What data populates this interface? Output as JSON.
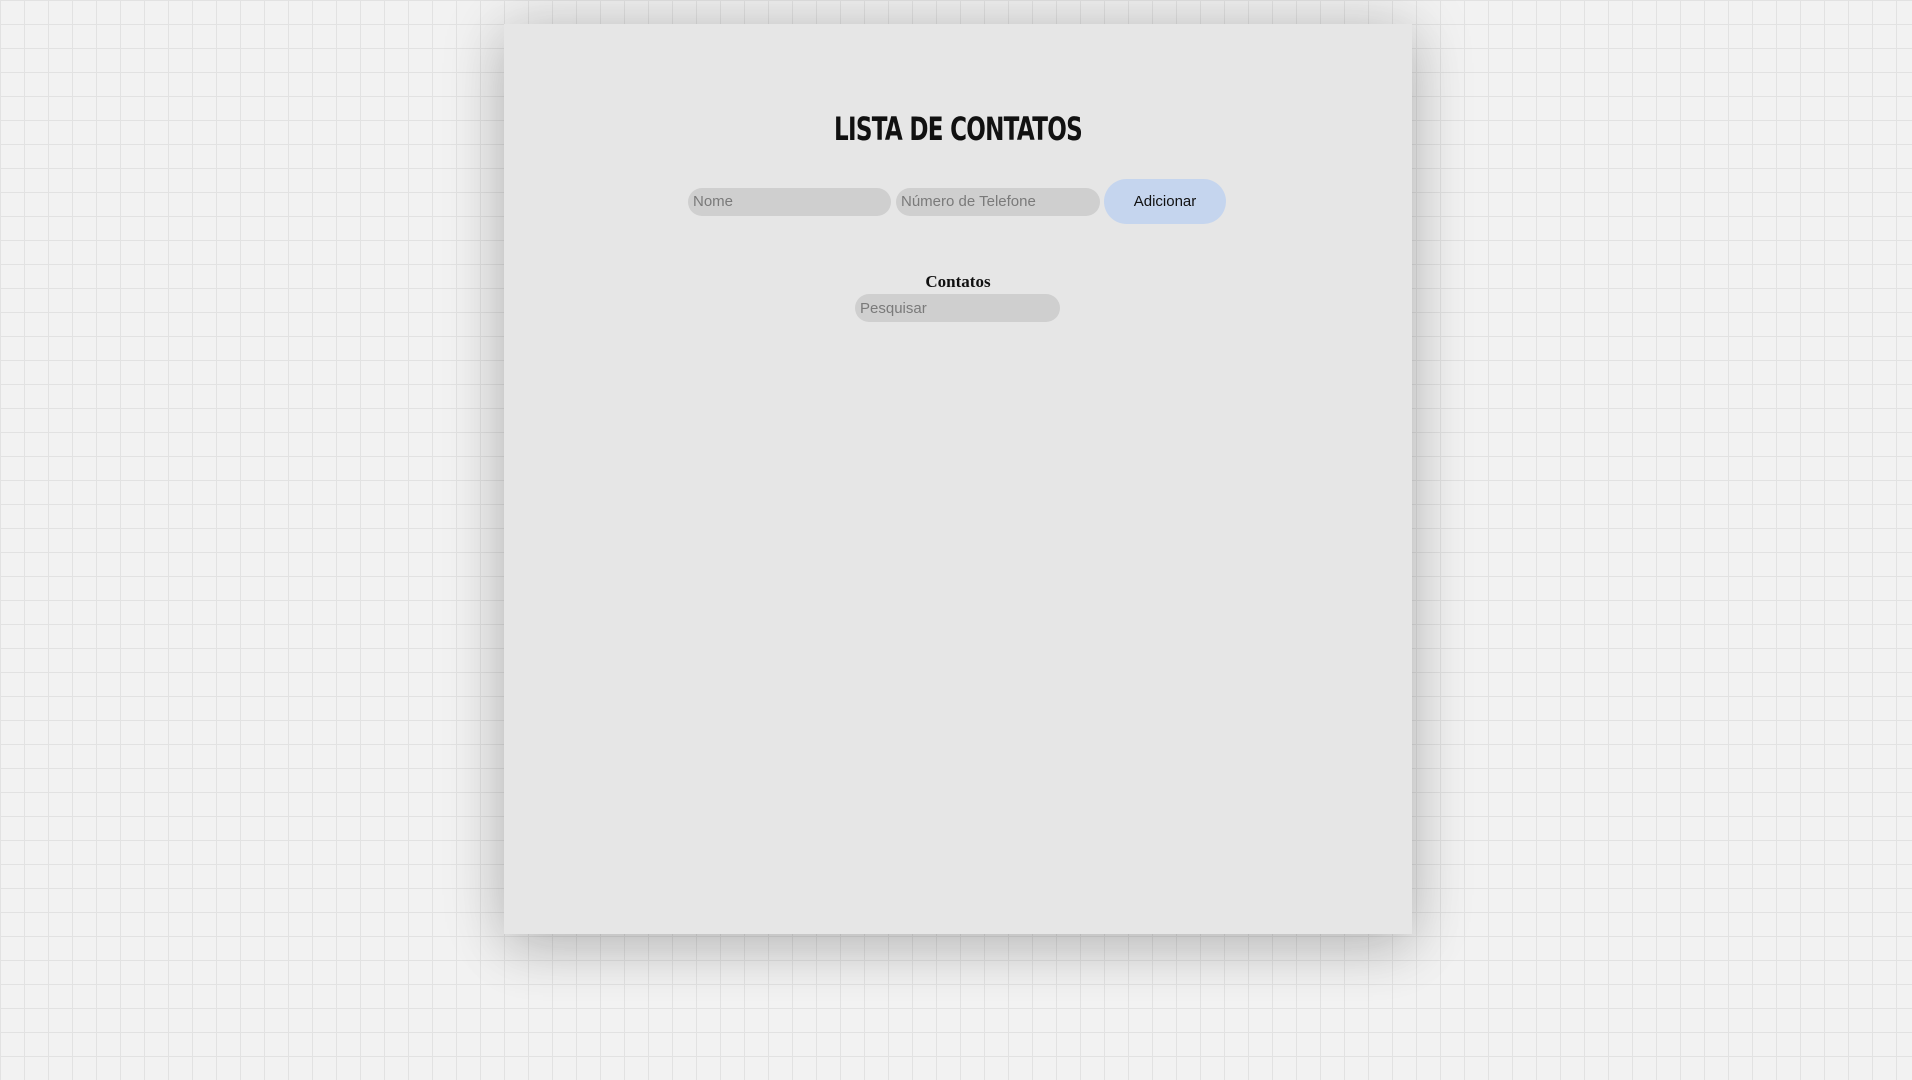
{
  "header": {
    "title": "Lista de Contatos"
  },
  "form": {
    "name_placeholder": "Nome",
    "phone_placeholder": "Número de Telefone",
    "add_label": "Adicionar"
  },
  "contacts": {
    "heading": "Contatos",
    "search_placeholder": "Pesquisar",
    "items": []
  },
  "colors": {
    "background": "#f2f2f2",
    "grid_line": "#e2e2e2",
    "card": "#e6e6e6",
    "input_fill": "#cfcfcf",
    "button_fill": "#c5d5ee"
  }
}
